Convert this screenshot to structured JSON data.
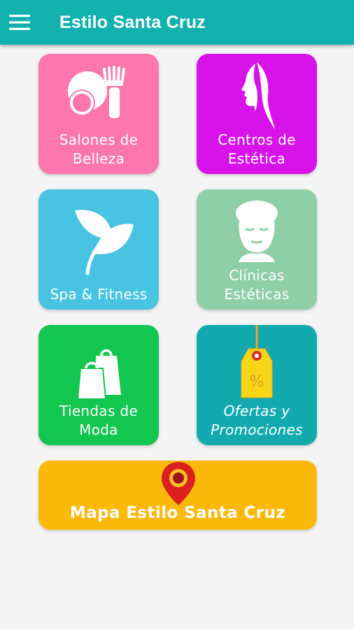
{
  "app_bar": {
    "title": "Estilo Santa Cruz",
    "menu_icon": "hamburger-menu-icon",
    "background": "#13b1ae"
  },
  "categories": [
    {
      "line1": "Salones de",
      "line2": "Belleza",
      "icon": "makeup-brush-icon",
      "color": "#fd76ac"
    },
    {
      "line1": "Centros de",
      "line2": "Estética",
      "icon": "woman-face-silhouette-icon",
      "color": "#d713e9"
    },
    {
      "line1": "Spa & Fitness",
      "line2": "",
      "icon": "leaves-icon",
      "color": "#48c3e1"
    },
    {
      "line1": "Clínicas",
      "line2": "Estéticas",
      "icon": "face-mask-towel-icon",
      "color": "#8fcfa7"
    },
    {
      "line1": "Tiendas de",
      "line2": "Moda",
      "icon": "shopping-bags-icon",
      "color": "#12c64f"
    },
    {
      "line1": "Ofertas y",
      "line2": "Promociones",
      "icon": "price-tag-percent-icon",
      "color": "#12aaaf"
    }
  ],
  "map_button": {
    "label": "Mapa Estilo Santa Cruz",
    "icon": "map-pin-icon",
    "color": "#fdb90a"
  }
}
